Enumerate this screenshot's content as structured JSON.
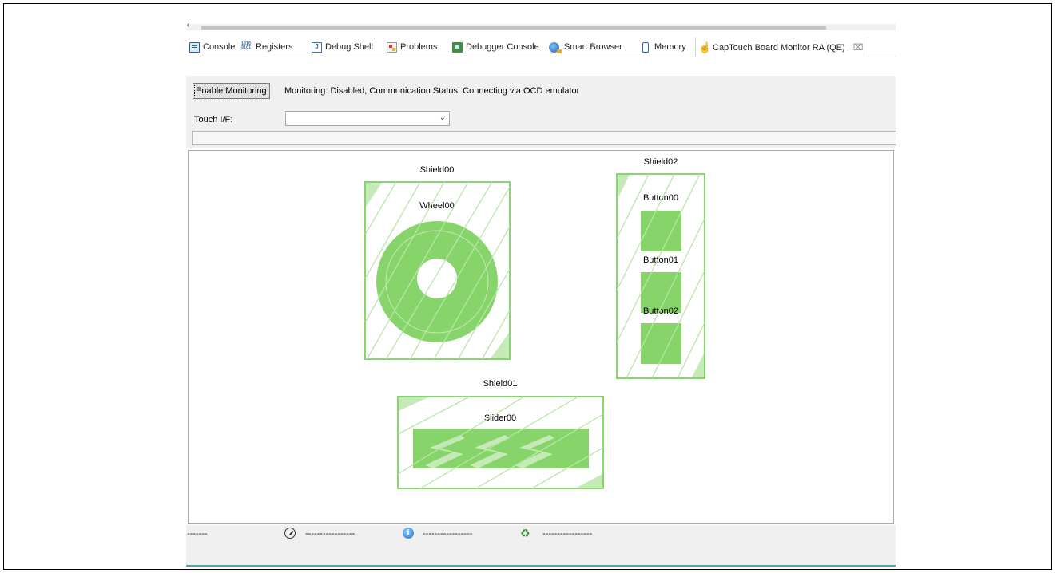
{
  "scrollbar": {
    "left_arrow": "‹"
  },
  "tabs": [
    {
      "label": "Console",
      "icon": "console-icon"
    },
    {
      "label": "Registers",
      "icon": "registers-icon"
    },
    {
      "label": "Debug Shell",
      "icon": "debug-shell-icon"
    },
    {
      "label": "Problems",
      "icon": "problems-icon"
    },
    {
      "label": "Debugger Console",
      "icon": "debugger-console-icon"
    },
    {
      "label": "Smart Browser",
      "icon": "smart-browser-icon"
    },
    {
      "label": "Memory",
      "icon": "memory-icon"
    },
    {
      "label": "CapTouch Board Monitor RA (QE)",
      "icon": "captouch-icon",
      "active": true,
      "close": "⌧"
    }
  ],
  "monitor": {
    "enable_button": "Enable Monitoring",
    "status": "Monitoring: Disabled, Communication Status: Connecting via OCD emulator",
    "touch_if_label": "Touch I/F:",
    "touch_if_value": "",
    "dropdown_arrow": "⌄"
  },
  "board": {
    "shield_color": "#84d76c",
    "shield_light": "#c5eab7",
    "element_fill": "#86d46a",
    "shields": [
      {
        "label": "Shield00"
      },
      {
        "label": "Shield02"
      },
      {
        "label": "Shield01"
      }
    ],
    "elements": [
      {
        "label": "Wheel00",
        "type": "wheel"
      },
      {
        "label": "Button00",
        "type": "button"
      },
      {
        "label": "Button01",
        "type": "button"
      },
      {
        "label": "Button02",
        "type": "button"
      },
      {
        "label": "Slider00",
        "type": "slider"
      }
    ]
  },
  "statusbar": {
    "left": "-------",
    "timer_icon": "timer-icon",
    "timer_value": "-----------------",
    "info_icon": "info-icon",
    "info_value": "-----------------",
    "refresh_icon": "refresh-icon",
    "refresh_value": "-----------------"
  }
}
